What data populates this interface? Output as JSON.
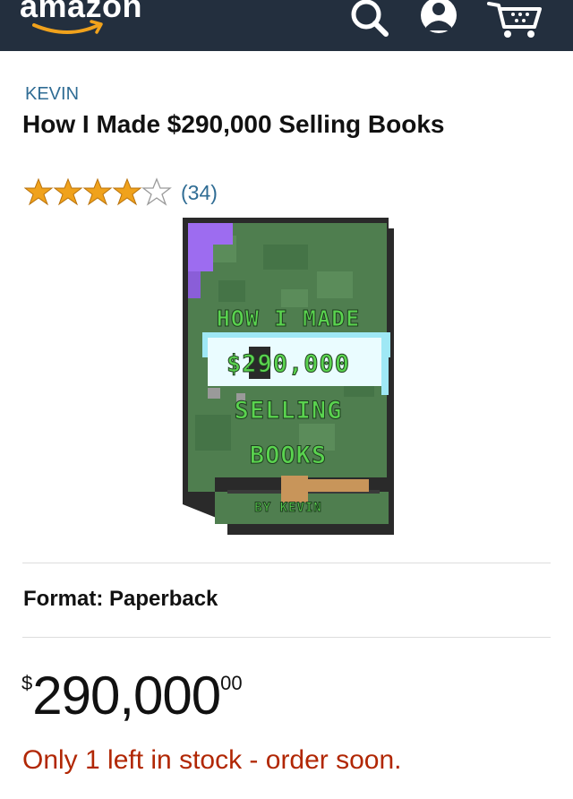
{
  "header": {
    "logo_text": "amazon",
    "icons": [
      "search-icon",
      "account-icon",
      "cart-icon"
    ],
    "background_color": "#232f3e"
  },
  "product": {
    "author": "KEVIN",
    "title": "How I Made $290,000 Selling Books",
    "rating": {
      "stars": 4,
      "max_stars": 5,
      "review_count": "(34)"
    },
    "cover": {
      "line1": "HOW I MADE",
      "line2": "$290,000",
      "line3": "SELLING",
      "line4": "BOOKS",
      "byline": "BY KEVIN"
    },
    "format_label": "Format: Paperback",
    "price": {
      "currency": "$",
      "whole": "290,000",
      "fraction": "00"
    },
    "stock_message": "Only 1 left in stock - order soon."
  },
  "colors": {
    "link": "#2f6c94",
    "star": "#f0a21c",
    "stock_warning": "#b12704"
  }
}
